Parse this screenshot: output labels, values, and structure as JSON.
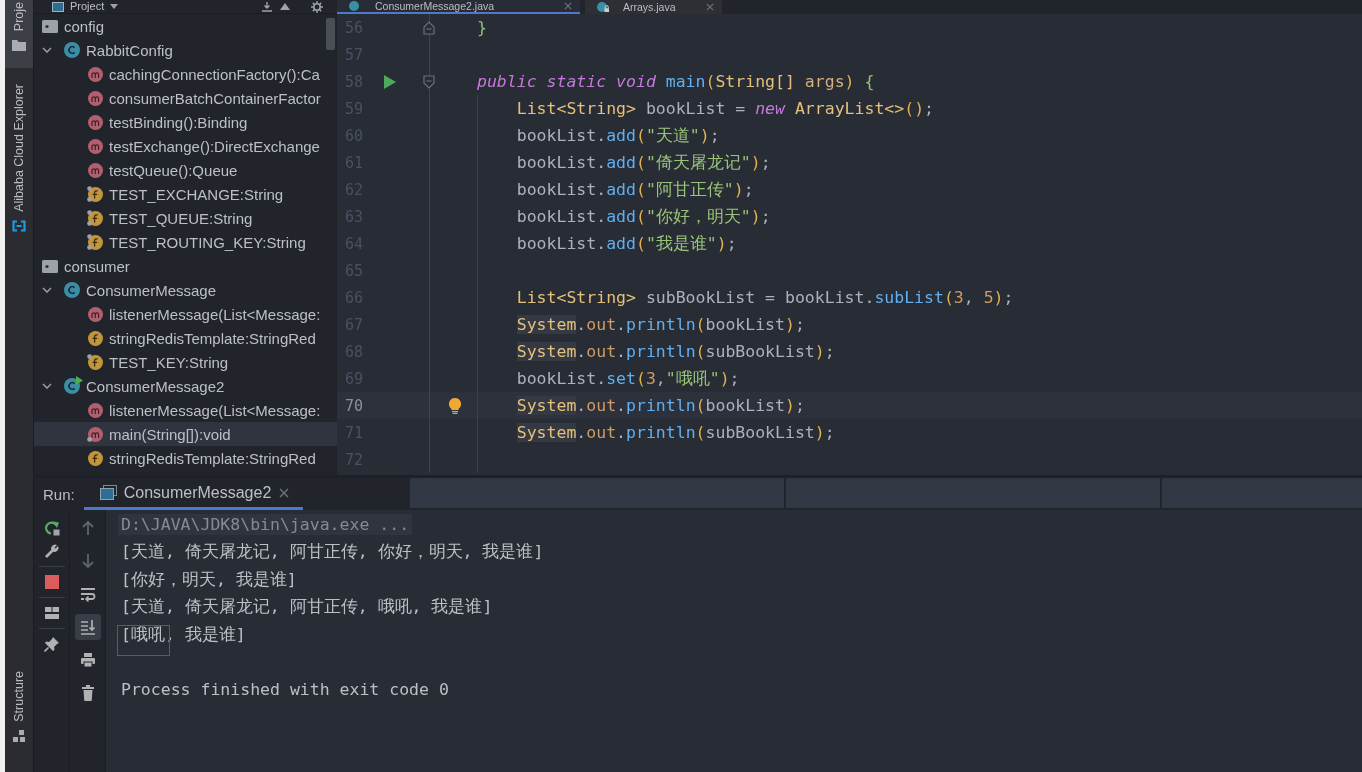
{
  "tool_strip": {
    "top": [
      {
        "label": "Proje",
        "kind": "project",
        "selected": true
      },
      {
        "label": "Alibaba Cloud Explorer",
        "kind": "cloud",
        "selected": false
      }
    ],
    "bottom": [
      {
        "label": "Structure",
        "kind": "structure",
        "selected": false
      }
    ]
  },
  "project": {
    "title": "Project",
    "tree": [
      {
        "label": "config",
        "kind": "package",
        "selected": false,
        "children": [
          {
            "label": "RabbitConfig",
            "kind": "class",
            "expanded": true,
            "runnable": false,
            "selected": false,
            "children": [
              {
                "label": "cachingConnectionFactory():Ca",
                "kind": "method",
                "static": false,
                "final": false,
                "selected": false
              },
              {
                "label": "consumerBatchContainerFactor",
                "kind": "method",
                "static": false,
                "final": false,
                "selected": false
              },
              {
                "label": "testBinding():Binding",
                "kind": "method",
                "static": false,
                "final": false,
                "selected": false
              },
              {
                "label": "testExchange():DirectExchange",
                "kind": "method",
                "static": false,
                "final": false,
                "selected": false
              },
              {
                "label": "testQueue():Queue",
                "kind": "method",
                "static": false,
                "final": false,
                "selected": false
              },
              {
                "label": "TEST_EXCHANGE:String",
                "kind": "field",
                "static": true,
                "final": true,
                "selected": false
              },
              {
                "label": "TEST_QUEUE:String",
                "kind": "field",
                "static": true,
                "final": true,
                "selected": false
              },
              {
                "label": "TEST_ROUTING_KEY:String",
                "kind": "field",
                "static": true,
                "final": true,
                "selected": false
              }
            ]
          }
        ]
      },
      {
        "label": "consumer",
        "kind": "package",
        "selected": false,
        "children": [
          {
            "label": "ConsumerMessage",
            "kind": "class",
            "expanded": true,
            "runnable": false,
            "selected": false,
            "children": [
              {
                "label": "listenerMessage(List<Message:",
                "kind": "method",
                "static": false,
                "final": false,
                "selected": false
              },
              {
                "label": "stringRedisTemplate:StringRed",
                "kind": "field",
                "static": false,
                "final": false,
                "selected": false
              },
              {
                "label": "TEST_KEY:String",
                "kind": "field",
                "static": false,
                "final": true,
                "selected": false
              }
            ]
          },
          {
            "label": "ConsumerMessage2",
            "kind": "class",
            "expanded": true,
            "runnable": true,
            "selected": false,
            "children": [
              {
                "label": "listenerMessage(List<Message:",
                "kind": "method",
                "static": false,
                "final": false,
                "selected": false
              },
              {
                "label": "main(String[]):void",
                "kind": "method",
                "static": true,
                "final": false,
                "selected": true
              },
              {
                "label": "stringRedisTemplate:StringRed",
                "kind": "field",
                "static": false,
                "final": false,
                "selected": false
              }
            ]
          }
        ]
      }
    ]
  },
  "editor": {
    "tabs": [
      {
        "label": "ConsumerMessage2.java",
        "selected": true,
        "read_only": false
      },
      {
        "label": "Arrays.java",
        "selected": false,
        "read_only": true
      }
    ],
    "lines": [
      {
        "number": "56",
        "current": false,
        "run_marker": false,
        "bulb": false,
        "fold_start": false,
        "fold_end": true,
        "tokens": [
          {
            "text": "}",
            "kind": "brace"
          }
        ]
      },
      {
        "number": "57",
        "current": false,
        "run_marker": false,
        "bulb": false,
        "fold_start": false,
        "fold_end": false
      },
      {
        "number": "58",
        "current": false,
        "run_marker": true,
        "bulb": false,
        "fold_start": true,
        "fold_end": false,
        "tokens": [
          {
            "text": "public static void ",
            "kind": "keyword"
          },
          {
            "text": "main",
            "kind": "method"
          },
          {
            "text": "(",
            "kind": "paren"
          },
          {
            "text": "String[] ",
            "kind": "type"
          },
          {
            "text": "args",
            "kind": "param"
          },
          {
            "text": ") ",
            "kind": "paren"
          },
          {
            "text": "{",
            "kind": "brace"
          }
        ],
        "children": [
          {
            "number": "59",
            "current": false,
            "run_marker": false,
            "bulb": false,
            "fold_start": false,
            "fold_end": false,
            "tokens": [
              {
                "text": "List<String>",
                "kind": "type"
              },
              {
                "text": " bookList = ",
                "kind": "plain"
              },
              {
                "text": "new",
                "kind": "keyword"
              },
              {
                "text": " ArrayList<>",
                "kind": "type"
              },
              {
                "text": "()",
                "kind": "paren"
              },
              {
                "text": ";",
                "kind": "plain"
              }
            ]
          },
          {
            "number": "60",
            "current": false,
            "run_marker": false,
            "bulb": false,
            "fold_start": false,
            "fold_end": false,
            "tokens": [
              {
                "text": "bookList.",
                "kind": "plain"
              },
              {
                "text": "add",
                "kind": "method"
              },
              {
                "text": "(",
                "kind": "paren"
              },
              {
                "text": "\"天道\"",
                "kind": "string"
              },
              {
                "text": ")",
                "kind": "paren"
              },
              {
                "text": ";",
                "kind": "plain"
              }
            ]
          },
          {
            "number": "61",
            "current": false,
            "run_marker": false,
            "bulb": false,
            "fold_start": false,
            "fold_end": false,
            "tokens": [
              {
                "text": "bookList.",
                "kind": "plain"
              },
              {
                "text": "add",
                "kind": "method"
              },
              {
                "text": "(",
                "kind": "paren"
              },
              {
                "text": "\"倚天屠龙记\"",
                "kind": "string"
              },
              {
                "text": ")",
                "kind": "paren"
              },
              {
                "text": ";",
                "kind": "plain"
              }
            ]
          },
          {
            "number": "62",
            "current": false,
            "run_marker": false,
            "bulb": false,
            "fold_start": false,
            "fold_end": false,
            "tokens": [
              {
                "text": "bookList.",
                "kind": "plain"
              },
              {
                "text": "add",
                "kind": "method"
              },
              {
                "text": "(",
                "kind": "paren"
              },
              {
                "text": "\"阿甘正传\"",
                "kind": "string"
              },
              {
                "text": ")",
                "kind": "paren"
              },
              {
                "text": ";",
                "kind": "plain"
              }
            ]
          },
          {
            "number": "63",
            "current": false,
            "run_marker": false,
            "bulb": false,
            "fold_start": false,
            "fold_end": false,
            "tokens": [
              {
                "text": "bookList.",
                "kind": "plain"
              },
              {
                "text": "add",
                "kind": "method"
              },
              {
                "text": "(",
                "kind": "paren"
              },
              {
                "text": "\"你好，明天\"",
                "kind": "string"
              },
              {
                "text": ")",
                "kind": "paren"
              },
              {
                "text": ";",
                "kind": "plain"
              }
            ]
          },
          {
            "number": "64",
            "current": false,
            "run_marker": false,
            "bulb": false,
            "fold_start": false,
            "fold_end": false,
            "tokens": [
              {
                "text": "bookList.",
                "kind": "plain"
              },
              {
                "text": "add",
                "kind": "method"
              },
              {
                "text": "(",
                "kind": "paren"
              },
              {
                "text": "\"我是谁\"",
                "kind": "string"
              },
              {
                "text": ")",
                "kind": "paren"
              },
              {
                "text": ";",
                "kind": "plain"
              }
            ]
          },
          {
            "number": "65",
            "current": false,
            "run_marker": false,
            "bulb": false,
            "fold_start": false,
            "fold_end": false
          },
          {
            "number": "66",
            "current": false,
            "run_marker": false,
            "bulb": false,
            "fold_start": false,
            "fold_end": false,
            "tokens": [
              {
                "text": "List<String>",
                "kind": "type"
              },
              {
                "text": " subBookList = bookList.",
                "kind": "plain"
              },
              {
                "text": "subList",
                "kind": "method"
              },
              {
                "text": "(",
                "kind": "paren"
              },
              {
                "text": "3",
                "kind": "number"
              },
              {
                "text": ", ",
                "kind": "plain"
              },
              {
                "text": "5",
                "kind": "number"
              },
              {
                "text": ")",
                "kind": "paren"
              },
              {
                "text": ";",
                "kind": "plain"
              }
            ]
          },
          {
            "number": "67",
            "current": false,
            "run_marker": false,
            "bulb": false,
            "fold_start": false,
            "fold_end": false,
            "tokens": [
              {
                "text": "System",
                "kind": "class_ref"
              },
              {
                "text": ".",
                "kind": "plain"
              },
              {
                "text": "out",
                "kind": "field"
              },
              {
                "text": ".",
                "kind": "plain"
              },
              {
                "text": "println",
                "kind": "method"
              },
              {
                "text": "(",
                "kind": "paren"
              },
              {
                "text": "bookList",
                "kind": "plain"
              },
              {
                "text": ")",
                "kind": "paren"
              },
              {
                "text": ";",
                "kind": "plain"
              }
            ]
          },
          {
            "number": "68",
            "current": false,
            "run_marker": false,
            "bulb": false,
            "fold_start": false,
            "fold_end": false,
            "tokens": [
              {
                "text": "System",
                "kind": "class_ref"
              },
              {
                "text": ".",
                "kind": "plain"
              },
              {
                "text": "out",
                "kind": "field"
              },
              {
                "text": ".",
                "kind": "plain"
              },
              {
                "text": "println",
                "kind": "method"
              },
              {
                "text": "(",
                "kind": "paren"
              },
              {
                "text": "subBookList",
                "kind": "plain"
              },
              {
                "text": ")",
                "kind": "paren"
              },
              {
                "text": ";",
                "kind": "plain"
              }
            ]
          },
          {
            "number": "69",
            "current": false,
            "run_marker": false,
            "bulb": false,
            "fold_start": false,
            "fold_end": false,
            "tokens": [
              {
                "text": "bookList.",
                "kind": "plain"
              },
              {
                "text": "set",
                "kind": "method"
              },
              {
                "text": "(",
                "kind": "paren"
              },
              {
                "text": "3",
                "kind": "number"
              },
              {
                "text": ",",
                "kind": "plain"
              },
              {
                "text": "\"哦吼\"",
                "kind": "string"
              },
              {
                "text": ")",
                "kind": "paren"
              },
              {
                "text": ";",
                "kind": "plain"
              }
            ]
          },
          {
            "number": "70",
            "current": true,
            "run_marker": false,
            "bulb": true,
            "fold_start": false,
            "fold_end": false,
            "tokens": [
              {
                "text": "System",
                "kind": "class_ref"
              },
              {
                "text": ".",
                "kind": "plain"
              },
              {
                "text": "out",
                "kind": "field"
              },
              {
                "text": ".",
                "kind": "plain"
              },
              {
                "text": "println",
                "kind": "method"
              },
              {
                "text": "(",
                "kind": "paren"
              },
              {
                "text": "bookList",
                "kind": "plain"
              },
              {
                "text": ")",
                "kind": "paren"
              },
              {
                "text": ";",
                "kind": "plain"
              }
            ]
          },
          {
            "number": "71",
            "current": false,
            "run_marker": false,
            "bulb": false,
            "fold_start": false,
            "fold_end": false,
            "tokens": [
              {
                "text": "System",
                "kind": "class_ref"
              },
              {
                "text": ".",
                "kind": "plain"
              },
              {
                "text": "out",
                "kind": "field"
              },
              {
                "text": ".",
                "kind": "plain"
              },
              {
                "text": "println",
                "kind": "method"
              },
              {
                "text": "(",
                "kind": "paren"
              },
              {
                "text": "subBookList",
                "kind": "plain"
              },
              {
                "text": ")",
                "kind": "paren"
              },
              {
                "text": ";",
                "kind": "plain"
              }
            ]
          },
          {
            "number": "72",
            "current": false,
            "run_marker": false,
            "bulb": false,
            "fold_start": false,
            "fold_end": false
          }
        ]
      }
    ]
  },
  "run": {
    "label": "Run:",
    "tabs": [
      {
        "label": "ConsumerMessage2",
        "selected": true
      }
    ],
    "soft_wrap": {
      "on": false
    },
    "scroll_to_end": {
      "on": true
    },
    "console": [
      {
        "kind": "command",
        "text": "D:\\JAVA\\JDK8\\bin\\java.exe ...",
        "marked": false
      },
      {
        "kind": "output",
        "text": "[天道, 倚天屠龙记, 阿甘正传, 你好，明天, 我是谁]",
        "marked": false
      },
      {
        "kind": "output",
        "text": "[你好，明天, 我是谁]",
        "marked": false
      },
      {
        "kind": "output",
        "text": "[天道, 倚天屠龙记, 阿甘正传, 哦吼, 我是谁]",
        "marked": false
      },
      {
        "kind": "output",
        "text": "[哦吼, 我是谁]",
        "marked": true
      },
      {
        "kind": "blank"
      },
      {
        "kind": "exit",
        "text": "Process finished with exit code 0",
        "marked": false
      }
    ]
  }
}
